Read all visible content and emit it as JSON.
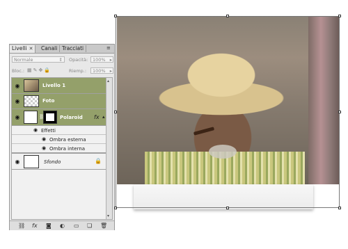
{
  "tabs": [
    {
      "label": "Livelli",
      "close": "✕"
    },
    {
      "label": "Canali"
    },
    {
      "label": "Tracciati"
    }
  ],
  "blend_mode": "Normale",
  "opacity_label": "Opacità:",
  "opacity_value": "100%",
  "lock_label": "Bloc.:",
  "fill_label": "Riemp.:",
  "fill_value": "100%",
  "layers": [
    {
      "name": "Livello 1"
    },
    {
      "name": "Foto"
    },
    {
      "name": "Polaroid",
      "fx": "fx"
    },
    {
      "name": "Effetti"
    },
    {
      "name": "Ombra esterna"
    },
    {
      "name": "Ombra interna"
    },
    {
      "name": "Sfondo"
    }
  ],
  "colors": {
    "selected_layer": "#94a06a"
  }
}
